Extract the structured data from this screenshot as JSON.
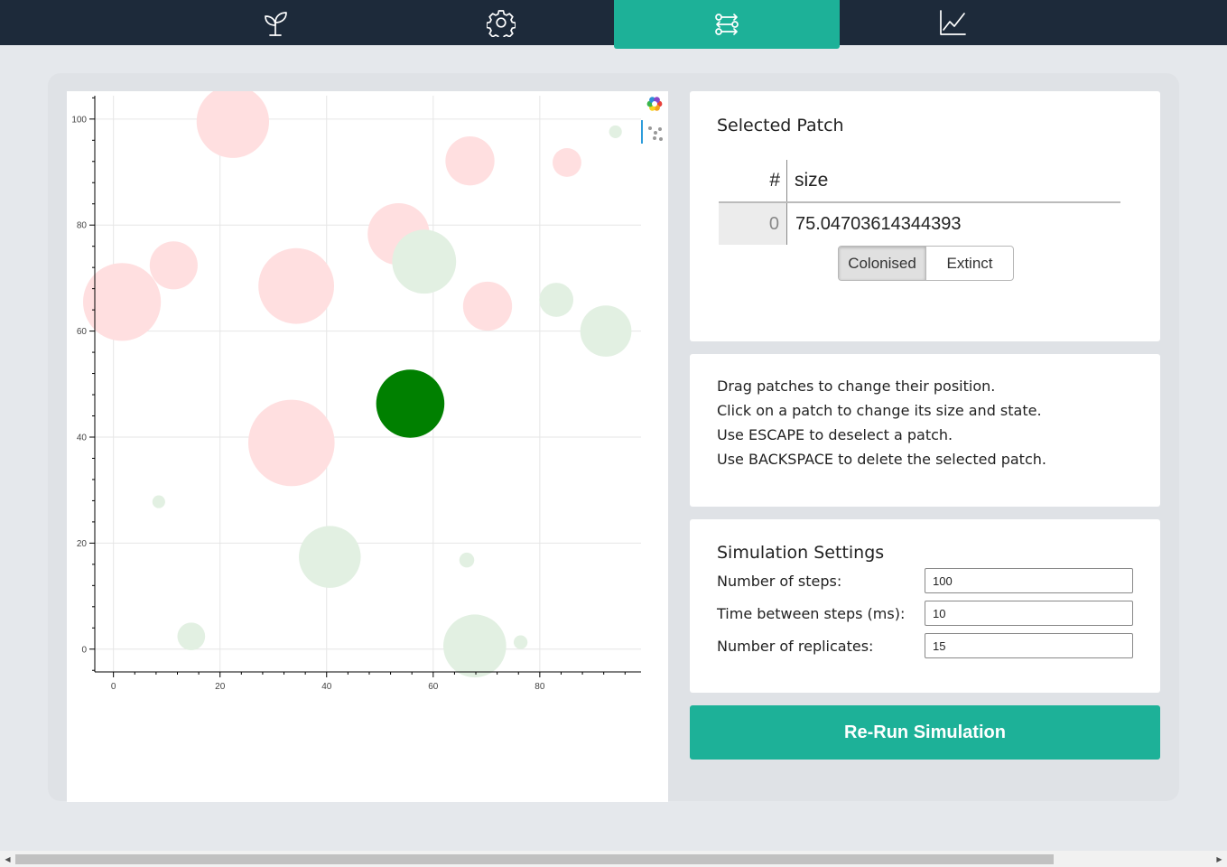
{
  "nav": {
    "tabs": [
      {
        "icon": "sprout-icon",
        "active": false
      },
      {
        "icon": "gear-icon",
        "active": false
      },
      {
        "icon": "workflow-icon",
        "active": true
      },
      {
        "icon": "line-chart-icon",
        "active": false
      }
    ],
    "accent": "#1db198",
    "background": "#1d2a3a"
  },
  "plot": {
    "toolbar": [
      "color-wheel-icon",
      "scatter-tool-icon"
    ],
    "xticks": [
      "0",
      "20",
      "40",
      "60",
      "80"
    ],
    "yticks": [
      "0",
      "20",
      "40",
      "60",
      "80",
      "100"
    ],
    "xlim": [
      -3.5,
      99
    ],
    "ylim": [
      -4.3,
      104.4
    ],
    "colors": {
      "extinct": "#ffdfe0",
      "colonised": "#e2f0e2",
      "selected": "#008000"
    },
    "patches": [
      {
        "x": 22.4,
        "y": 99.5,
        "r": 6.8,
        "state": "extinct"
      },
      {
        "x": 66.9,
        "y": 92.1,
        "r": 4.6,
        "state": "extinct"
      },
      {
        "x": 85.1,
        "y": 91.8,
        "r": 2.7,
        "state": "extinct"
      },
      {
        "x": 94.2,
        "y": 97.6,
        "r": 1.2,
        "state": "colonised"
      },
      {
        "x": 53.5,
        "y": 78.3,
        "r": 5.8,
        "state": "extinct"
      },
      {
        "x": 58.3,
        "y": 73.1,
        "r": 6.0,
        "state": "colonised"
      },
      {
        "x": 11.3,
        "y": 72.4,
        "r": 4.5,
        "state": "extinct"
      },
      {
        "x": 1.6,
        "y": 65.5,
        "r": 7.3,
        "state": "extinct"
      },
      {
        "x": 34.3,
        "y": 68.5,
        "r": 7.1,
        "state": "extinct"
      },
      {
        "x": 70.2,
        "y": 64.7,
        "r": 4.6,
        "state": "extinct"
      },
      {
        "x": 83.1,
        "y": 65.9,
        "r": 3.2,
        "state": "colonised"
      },
      {
        "x": 92.4,
        "y": 60.0,
        "r": 4.8,
        "state": "colonised"
      },
      {
        "x": 55.7,
        "y": 46.3,
        "r": 6.4,
        "state": "selected"
      },
      {
        "x": 33.4,
        "y": 38.9,
        "r": 8.1,
        "state": "extinct"
      },
      {
        "x": 8.5,
        "y": 27.8,
        "r": 1.2,
        "state": "colonised"
      },
      {
        "x": 40.6,
        "y": 17.4,
        "r": 5.8,
        "state": "colonised"
      },
      {
        "x": 66.3,
        "y": 16.8,
        "r": 1.4,
        "state": "colonised"
      },
      {
        "x": 14.6,
        "y": 2.4,
        "r": 2.6,
        "state": "colonised"
      },
      {
        "x": 67.8,
        "y": 0.6,
        "r": 5.9,
        "state": "colonised"
      },
      {
        "x": 76.4,
        "y": 1.3,
        "r": 1.3,
        "state": "colonised"
      }
    ]
  },
  "selected_patch": {
    "title": "Selected Patch",
    "col_hash": "#",
    "col_size": "size",
    "row_index": "0",
    "size_value": "75.04703614344393",
    "state_options": [
      "Colonised",
      "Extinct"
    ],
    "active_state": "Colonised"
  },
  "instructions": [
    "Drag patches to change their position.",
    "Click on a patch to change its size and state.",
    "Use ESCAPE to deselect a patch.",
    "Use BACKSPACE to delete the selected patch."
  ],
  "settings": {
    "title": "Simulation Settings",
    "steps_label": "Number of steps:",
    "steps_value": "100",
    "time_label": "Time between steps (ms):",
    "time_value": "10",
    "replicates_label": "Number of replicates:",
    "replicates_value": "15"
  },
  "rerun_label": "Re-Run Simulation"
}
